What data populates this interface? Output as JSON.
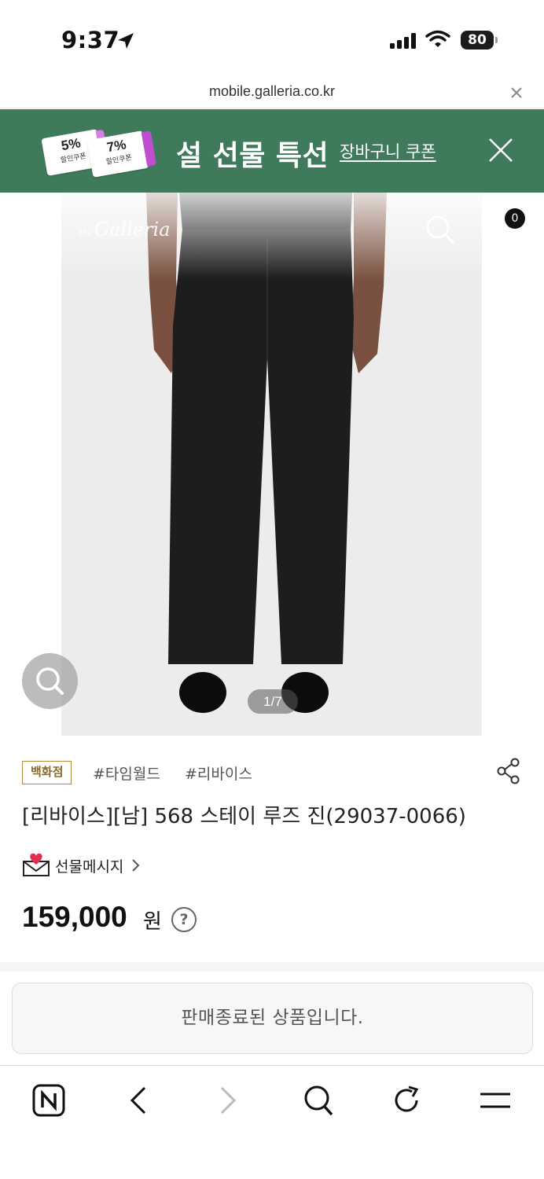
{
  "status_bar": {
    "time": "9:37",
    "battery": "80"
  },
  "url_bar": {
    "url": "mobile.galleria.co.kr"
  },
  "promo": {
    "coupons": [
      {
        "percent": "5%",
        "label": "할인쿠폰"
      },
      {
        "percent": "7%",
        "label": "할인쿠폰"
      }
    ],
    "title": "설 선물 특선",
    "link": "장바구니 쿠폰"
  },
  "gallery": {
    "logo": "Galleria",
    "logo_prefix": "the",
    "cart_count": "0",
    "counter": "1/7"
  },
  "product": {
    "dept_badge": "백화점",
    "hashtags": [
      "#타임월드",
      "#리바이스"
    ],
    "title": "[리바이스][남] 568 스테이 루즈 진(29037-0066)",
    "gift_message": "선물메시지",
    "price": "159,000",
    "price_unit": "원",
    "help": "?",
    "soldout_notice": "판매종료된 상품입니다."
  },
  "colors": {
    "promo_bg": "#3f7a5b",
    "badge_border": "#b08a3d"
  },
  "icons": [
    "location-arrow-icon",
    "signal-icon",
    "wifi-icon",
    "battery-icon",
    "close-icon",
    "back-icon",
    "search-icon",
    "shopping-bag-icon",
    "zoom-icon",
    "share-icon",
    "gift-envelope-icon",
    "chevron-right-icon",
    "help-icon",
    "naver-icon",
    "reload-icon",
    "menu-icon"
  ]
}
